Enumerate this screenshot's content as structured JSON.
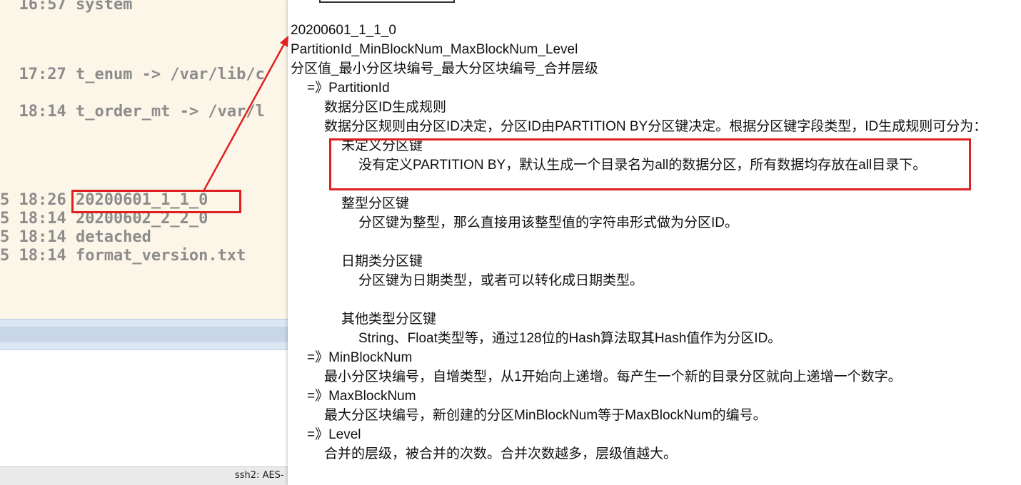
{
  "terminal": {
    "lines": [
      "  16:57 system",
      "  17:27 t_enum -> /var/lib/c",
      "  18:14 t_order_mt -> /var/l",
      "5 18:26 20200601_1_1_0",
      "5 18:14 20200602_2_2_0",
      "5 18:14 detached",
      "5 18:14 format_version.txt"
    ],
    "status_text": "ssh2: AES-"
  },
  "doc": {
    "lines": [
      "20200601_1_1_0",
      "PartitionId_MinBlockNum_MaxBlockNum_Level",
      "分区值_最小分区块编号_最大分区块编号_合并层级",
      "=》PartitionId",
      "数据分区ID生成规则",
      "数据分区规则由分区ID决定，分区ID由PARTITION BY分区键决定。根据分区键字段类型，ID生成规则可分为：",
      "未定义分区键",
      "没有定义PARTITION BY，默认生成一个目录名为all的数据分区，所有数据均存放在all目录下。",
      "整型分区键",
      "分区键为整型，那么直接用该整型值的字符串形式做为分区ID。",
      "日期类分区键",
      "分区键为日期类型，或者可以转化成日期类型。",
      "其他类型分区键",
      "String、Float类型等，通过128位的Hash算法取其Hash值作为分区ID。",
      "=》MinBlockNum",
      "最小分区块编号，自增类型，从1开始向上递增。每产生一个新的目录分区就向上递增一个数字。",
      "=》MaxBlockNum",
      "最大分区块编号，新创建的分区MinBlockNum等于MaxBlockNum的编号。",
      "=》Level",
      "合并的层级，被合并的次数。合并次数越多，层级值越大。"
    ]
  },
  "colors": {
    "annotation_red": "#e02020",
    "terminal_bg": "#fbf6e8",
    "terminal_text": "#8c8c8c"
  }
}
